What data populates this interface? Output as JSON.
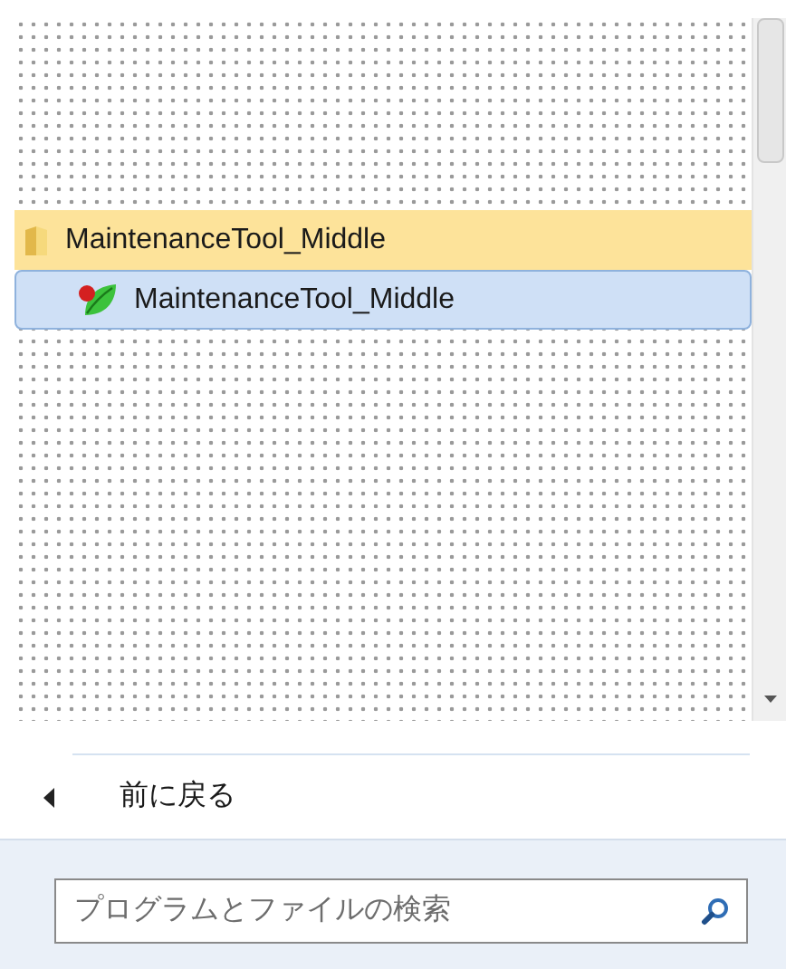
{
  "program_list": [
    {
      "kind": "folder",
      "label": "MaintenanceTool_Middle",
      "new": true,
      "selected": false
    },
    {
      "kind": "program",
      "label": "MaintenanceTool_Middle",
      "selected": true
    }
  ],
  "back": {
    "label": "前に戻る"
  },
  "search": {
    "placeholder": "プログラムとファイルの検索"
  }
}
